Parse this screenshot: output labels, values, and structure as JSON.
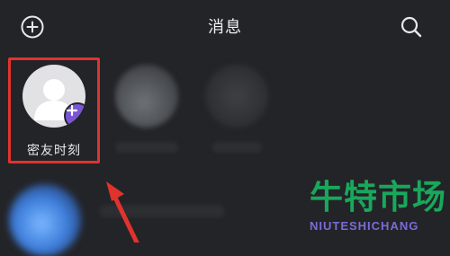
{
  "header": {
    "title": "消息",
    "left_icon": "add-circle-icon",
    "right_icon": "search-icon"
  },
  "stories": [
    {
      "label": "密友时刻",
      "badge_icon": "plus-icon",
      "accent": "#7b55d8"
    }
  ],
  "annotation": {
    "highlight_color": "#e0332e"
  },
  "watermark": {
    "main": "牛特市场",
    "sub": "NIUTESHICHANG",
    "main_color": "#19a85b",
    "sub_color": "#7a6bd8"
  }
}
